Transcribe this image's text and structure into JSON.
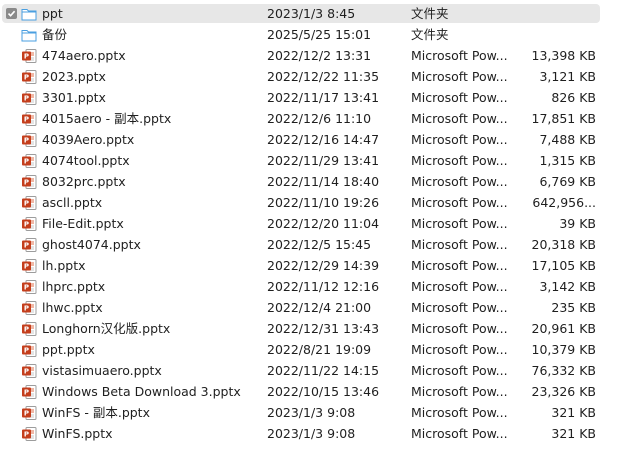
{
  "colors": {
    "selected_row": "#e7e7e7",
    "folder_icon": "#4a9fe0",
    "pptx_icon": "#c43e1c"
  },
  "files": [
    {
      "name": "ppt",
      "modified": "2023/1/3 8:45",
      "type": "文件夹",
      "size": "",
      "icon": "folder-icon",
      "selected": true
    },
    {
      "name": "备份",
      "modified": "2025/5/25 15:01",
      "type": "文件夹",
      "size": "",
      "icon": "folder-icon",
      "selected": false
    },
    {
      "name": "474aero.pptx",
      "modified": "2022/12/2 13:31",
      "type": "Microsoft Pow...",
      "size": "13,398 KB",
      "icon": "pptx-file-icon",
      "selected": false
    },
    {
      "name": "2023.pptx",
      "modified": "2022/12/22 11:35",
      "type": "Microsoft Pow...",
      "size": "3,121 KB",
      "icon": "pptx-file-icon",
      "selected": false
    },
    {
      "name": "3301.pptx",
      "modified": "2022/11/17 13:41",
      "type": "Microsoft Pow...",
      "size": "826 KB",
      "icon": "pptx-file-icon",
      "selected": false
    },
    {
      "name": "4015aero - 副本.pptx",
      "modified": "2022/12/6 11:10",
      "type": "Microsoft Pow...",
      "size": "17,851 KB",
      "icon": "pptx-file-icon",
      "selected": false
    },
    {
      "name": "4039Aero.pptx",
      "modified": "2022/12/16 14:47",
      "type": "Microsoft Pow...",
      "size": "7,488 KB",
      "icon": "pptx-file-icon",
      "selected": false
    },
    {
      "name": "4074tool.pptx",
      "modified": "2022/11/29 13:41",
      "type": "Microsoft Pow...",
      "size": "1,315 KB",
      "icon": "pptx-file-icon",
      "selected": false
    },
    {
      "name": "8032prc.pptx",
      "modified": "2022/11/14 18:40",
      "type": "Microsoft Pow...",
      "size": "6,769 KB",
      "icon": "pptx-file-icon",
      "selected": false
    },
    {
      "name": "ascll.pptx",
      "modified": "2022/11/10 19:26",
      "type": "Microsoft Pow...",
      "size": "642,956...",
      "icon": "pptx-file-icon",
      "selected": false
    },
    {
      "name": "File-Edit.pptx",
      "modified": "2022/12/20 11:04",
      "type": "Microsoft Pow...",
      "size": "39 KB",
      "icon": "pptx-file-icon",
      "selected": false
    },
    {
      "name": "ghost4074.pptx",
      "modified": "2022/12/5 15:45",
      "type": "Microsoft Pow...",
      "size": "20,318 KB",
      "icon": "pptx-file-icon",
      "selected": false
    },
    {
      "name": "lh.pptx",
      "modified": "2022/12/29 14:39",
      "type": "Microsoft Pow...",
      "size": "17,105 KB",
      "icon": "pptx-file-icon",
      "selected": false
    },
    {
      "name": "lhprc.pptx",
      "modified": "2022/11/12 12:16",
      "type": "Microsoft Pow...",
      "size": "3,142 KB",
      "icon": "pptx-file-icon",
      "selected": false
    },
    {
      "name": "lhwc.pptx",
      "modified": "2022/12/4 21:00",
      "type": "Microsoft Pow...",
      "size": "235 KB",
      "icon": "pptx-file-icon",
      "selected": false
    },
    {
      "name": "Longhorn汉化版.pptx",
      "modified": "2022/12/31 13:43",
      "type": "Microsoft Pow...",
      "size": "20,961 KB",
      "icon": "pptx-file-icon",
      "selected": false
    },
    {
      "name": "ppt.pptx",
      "modified": "2022/8/21 19:09",
      "type": "Microsoft Pow...",
      "size": "10,379 KB",
      "icon": "pptx-file-icon",
      "selected": false
    },
    {
      "name": "vistasimuaero.pptx",
      "modified": "2022/11/22 14:15",
      "type": "Microsoft Pow...",
      "size": "76,332 KB",
      "icon": "pptx-file-icon",
      "selected": false
    },
    {
      "name": "Windows Beta Download 3.pptx",
      "modified": "2022/10/15 13:46",
      "type": "Microsoft Pow...",
      "size": "23,326 KB",
      "icon": "pptx-file-icon",
      "selected": false
    },
    {
      "name": "WinFS - 副本.pptx",
      "modified": "2023/1/3 9:08",
      "type": "Microsoft Pow...",
      "size": "321 KB",
      "icon": "pptx-file-icon",
      "selected": false
    },
    {
      "name": "WinFS.pptx",
      "modified": "2023/1/3 9:08",
      "type": "Microsoft Pow...",
      "size": "321 KB",
      "icon": "pptx-file-icon",
      "selected": false
    }
  ]
}
